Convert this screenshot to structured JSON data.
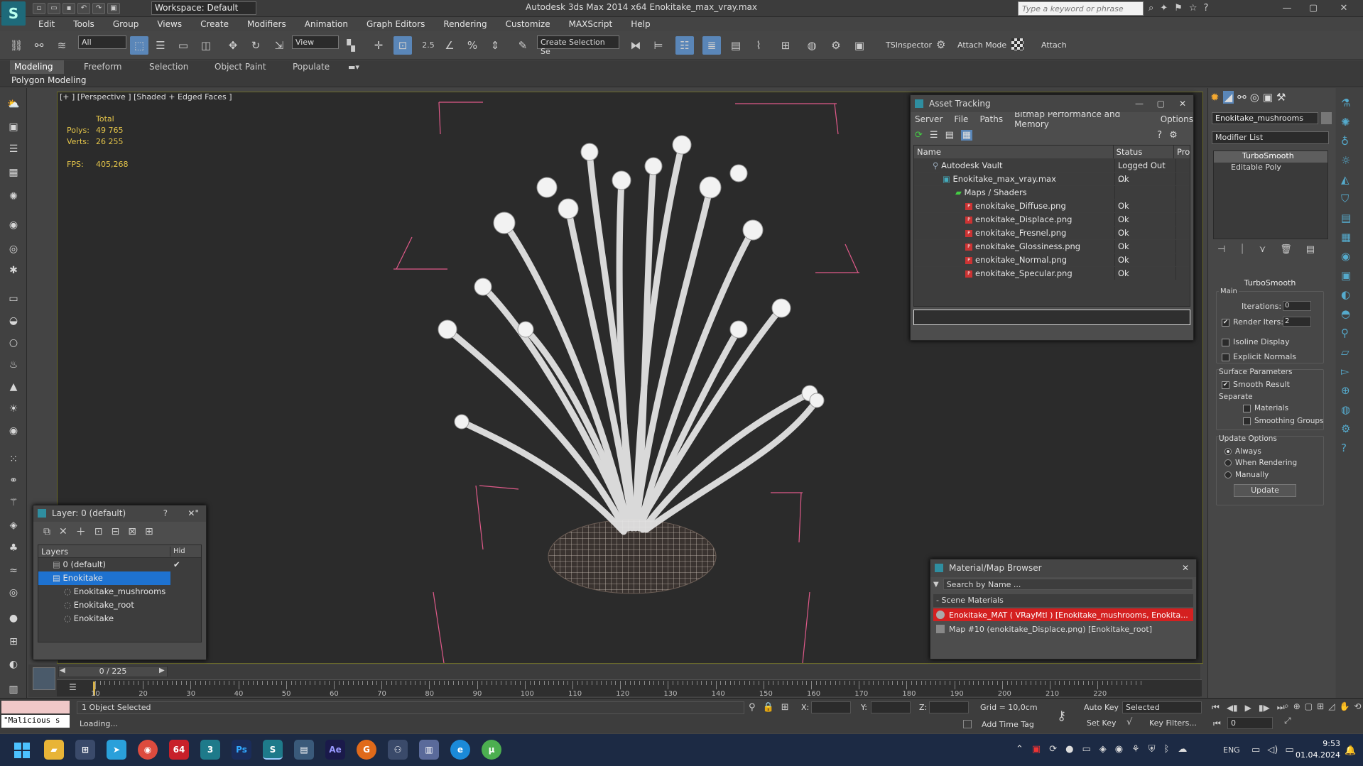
{
  "titlebar": {
    "workspace": "Workspace: Default",
    "app_title": "Autodesk 3ds Max  2014 x64     Enokitake_max_vray.max",
    "search_placeholder": "Type a keyword or phrase"
  },
  "menu": [
    "Edit",
    "Tools",
    "Group",
    "Views",
    "Create",
    "Modifiers",
    "Animation",
    "Graph Editors",
    "Rendering",
    "Customize",
    "MAXScript",
    "Help"
  ],
  "toolbar": {
    "filter": "All",
    "ref_coord": "View",
    "spinner_snap": "2.5",
    "selection_set": "Create Selection Se",
    "tsinspector": "TSInspector",
    "attach_mode": "Attach Mode",
    "attach": "Attach"
  },
  "ribbon": {
    "tabs": [
      "Modeling",
      "Freeform",
      "Selection",
      "Object Paint",
      "Populate"
    ],
    "panel": "Polygon Modeling"
  },
  "viewport": {
    "label": "[+ ] [Perspective ] [Shaded + Edged Faces ]",
    "stats": {
      "total_label": "Total",
      "polys_label": "Polys:",
      "polys": "49 765",
      "verts_label": "Verts:",
      "verts": "26 255",
      "fps_label": "FPS:",
      "fps": "405,268"
    }
  },
  "asset_tracking": {
    "title": "Asset Tracking",
    "menu": [
      "Server",
      "File",
      "Paths",
      "Bitmap Performance and Memory",
      "Options"
    ],
    "columns": [
      "Name",
      "Status",
      "Pro"
    ],
    "rows": [
      {
        "name": "Autodesk Vault",
        "status": "Logged Out ...",
        "indent": 1,
        "icon": "vault"
      },
      {
        "name": "Enokitake_max_vray.max",
        "status": "Ok",
        "indent": 2,
        "icon": "max"
      },
      {
        "name": "Maps / Shaders",
        "status": "",
        "indent": 3,
        "icon": "folder"
      },
      {
        "name": "enokitake_Diffuse.png",
        "status": "Ok",
        "indent": 4,
        "icon": "png"
      },
      {
        "name": "enokitake_Displace.png",
        "status": "Ok",
        "indent": 4,
        "icon": "png"
      },
      {
        "name": "enokitake_Fresnel.png",
        "status": "Ok",
        "indent": 4,
        "icon": "png"
      },
      {
        "name": "enokitake_Glossiness.png",
        "status": "Ok",
        "indent": 4,
        "icon": "png"
      },
      {
        "name": "enokitake_Normal.png",
        "status": "Ok",
        "indent": 4,
        "icon": "png"
      },
      {
        "name": "enokitake_Specular.png",
        "status": "Ok",
        "indent": 4,
        "icon": "png"
      }
    ]
  },
  "layer_manager": {
    "title": "Layer: 0 (default)",
    "help": "?",
    "columns": [
      "Layers",
      "Hid"
    ],
    "rows": [
      {
        "name": "0 (default)",
        "indent": 1,
        "selected": false
      },
      {
        "name": "Enokitake",
        "indent": 1,
        "selected": true
      },
      {
        "name": "Enokitake_mushrooms",
        "indent": 2,
        "selected": false
      },
      {
        "name": "Enokitake_root",
        "indent": 2,
        "selected": false
      },
      {
        "name": "Enokitake",
        "indent": 2,
        "selected": false
      }
    ]
  },
  "material_browser": {
    "title": "Material/Map Browser",
    "search_placeholder": "Search by Name ...",
    "group": "- Scene Materials",
    "items": [
      {
        "label": "Enokitake_MAT ( VRayMtl ) [Enokitake_mushrooms, Enokita...",
        "highlight": true
      },
      {
        "label": "Map #10 (enokitake_Displace.png) [Enokitake_root]",
        "highlight": false
      }
    ]
  },
  "command_panel": {
    "object_name": "Enokitake_mushrooms",
    "modifier_list": "Modifier List",
    "stack": [
      "TurboSmooth",
      "Editable Poly"
    ],
    "rollout_title": "TurboSmooth",
    "main_label": "Main",
    "iterations_label": "Iterations:",
    "iterations": "0",
    "render_iters_label": "Render Iters:",
    "render_iters": "2",
    "isoline": "Isoline Display",
    "explicit_normals": "Explicit Normals",
    "surface_params": "Surface Parameters",
    "smooth_result": "Smooth Result",
    "separate": "Separate",
    "materials": "Materials",
    "smoothing_groups": "Smoothing Groups",
    "update_options": "Update Options",
    "always": "Always",
    "when_rendering": "When Rendering",
    "manually": "Manually",
    "update_btn": "Update"
  },
  "timeline": {
    "frame": "0 / 225",
    "ticks": [
      "10",
      "20",
      "30",
      "40",
      "50",
      "60",
      "70",
      "80",
      "90",
      "100",
      "110",
      "120",
      "130",
      "140",
      "150",
      "160",
      "170",
      "180",
      "190",
      "200",
      "210",
      "220"
    ]
  },
  "status": {
    "selected": "1 Object Selected",
    "loading": "Loading...",
    "maxscript": "\"Malicious s",
    "x_label": "X:",
    "y_label": "Y:",
    "z_label": "Z:",
    "grid": "Grid = 10,0cm",
    "add_time_tag": "Add Time Tag",
    "auto_key": "Auto Key",
    "set_key": "Set Key",
    "selected_dropdown": "Selected",
    "key_filters": "Key Filters...",
    "frame_field": "0"
  },
  "taskbar": {
    "lang": "ENG",
    "time": "9:53",
    "date": "01.04.2024"
  },
  "colors": {
    "accent": "#5a86b8",
    "selection": "#1e72d0",
    "highlight_red": "#d42020",
    "bbox_pink": "#e05a8a"
  }
}
